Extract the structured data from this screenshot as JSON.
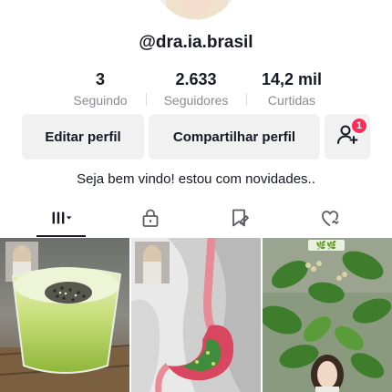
{
  "profile": {
    "username": "@dra.ia.brasil",
    "bio": "Seja bem vindo! estou com novidades.."
  },
  "stats": {
    "following": {
      "value": "3",
      "label": "Seguindo"
    },
    "followers": {
      "value": "2.633",
      "label": "Seguidores"
    },
    "likes": {
      "value": "14,2 mil",
      "label": "Curtidas"
    }
  },
  "actions": {
    "edit_label": "Editar perfil",
    "share_label": "Compartilhar perfil",
    "add_friends_badge": "1"
  },
  "tabs": [
    {
      "icon": "grid-icon",
      "active": true
    },
    {
      "icon": "lock-icon",
      "active": false
    },
    {
      "icon": "bookmark-icon",
      "active": false
    },
    {
      "icon": "liked-heart-icon",
      "active": false
    }
  ],
  "videos": [
    {
      "subject": "green juice with chia seeds in glass"
    },
    {
      "subject": "stomach anatomy illustration"
    },
    {
      "subject": "green leafy plant with woman",
      "tag": "🌿🌿"
    }
  ],
  "colors": {
    "accent": "#fe2c55",
    "text": "#161823",
    "muted": "#8a8b91",
    "button_bg": "#f1f1f2"
  }
}
